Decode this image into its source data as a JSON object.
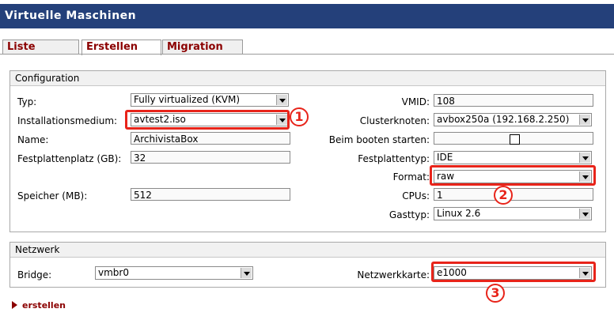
{
  "window": {
    "title": "Virtuelle Maschinen"
  },
  "tabs": [
    {
      "label": "Liste"
    },
    {
      "label": "Erstellen"
    },
    {
      "label": "Migration"
    }
  ],
  "configuration": {
    "legend": "Configuration",
    "typ": {
      "label": "Typ:",
      "value": "Fully virtualized (KVM)"
    },
    "installationsmedium": {
      "label": "Installationsmedium:",
      "value": "avtest2.iso"
    },
    "name": {
      "label": "Name:",
      "value": "ArchivistaBox"
    },
    "festplattenplatz": {
      "label": "Festplattenplatz (GB):",
      "value": "32"
    },
    "speicher": {
      "label": "Speicher (MB):",
      "value": "512"
    },
    "vmid": {
      "label": "VMID:",
      "value": "108"
    },
    "clusterknoten": {
      "label": "Clusterknoten:",
      "value": "avbox250a (192.168.2.250)"
    },
    "beim_booten": {
      "label": "Beim booten starten:"
    },
    "festplattentyp": {
      "label": "Festplattentyp:",
      "value": "IDE"
    },
    "format": {
      "label": "Format:",
      "value": "raw"
    },
    "cpus": {
      "label": "CPUs:",
      "value": "1"
    },
    "gasttyp": {
      "label": "Gasttyp:",
      "value": "Linux 2.6"
    }
  },
  "netzwerk": {
    "legend": "Netzwerk",
    "bridge": {
      "label": "Bridge:",
      "value": "vmbr0"
    },
    "netzwerkkarte": {
      "label": "Netzwerkkarte:",
      "value": "e1000"
    }
  },
  "annotations": [
    "1",
    "2",
    "3"
  ],
  "actions": {
    "create_label": "erstellen"
  },
  "colors": {
    "titlebar": "#24407a",
    "tab_text": "#8b0000",
    "highlight": "#e8241a"
  }
}
